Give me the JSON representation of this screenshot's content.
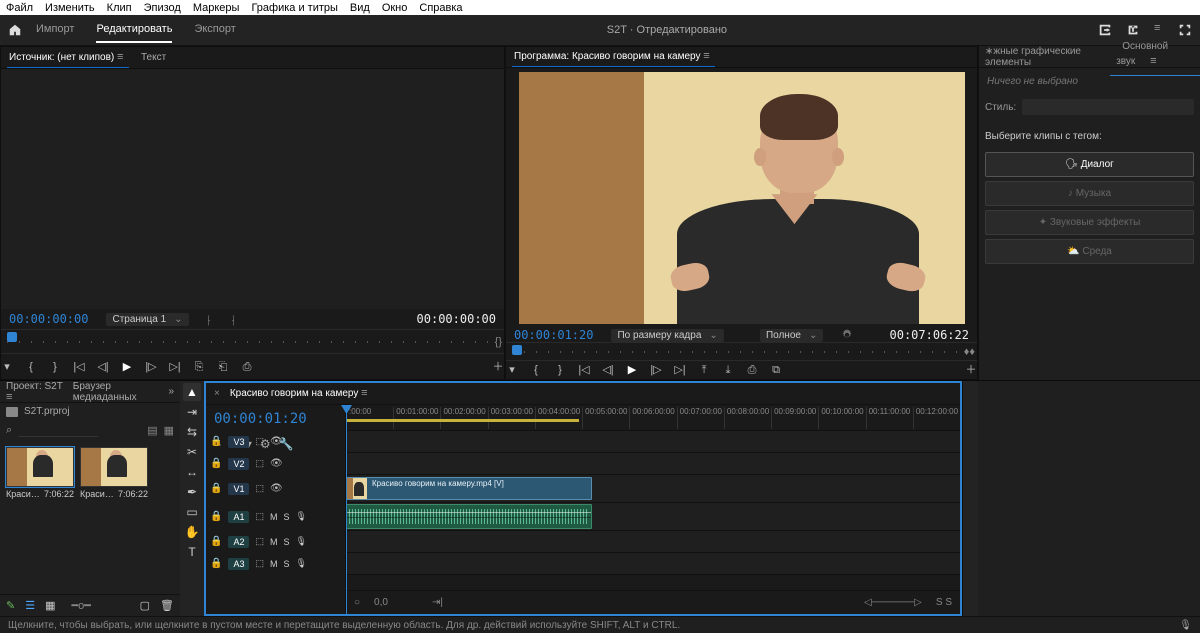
{
  "menubar": [
    "Файл",
    "Изменить",
    "Клип",
    "Эпизод",
    "Маркеры",
    "Графика и титры",
    "Вид",
    "Окно",
    "Справка"
  ],
  "topbar": {
    "tabs": [
      "Импорт",
      "Редактировать",
      "Экспорт"
    ],
    "active": 1,
    "title": "S2T  · Отредактировано"
  },
  "source": {
    "tab_source": "Источник: (нет клипов)",
    "tab_text": "Текст",
    "tc_left": "00:00:00:00",
    "page_dd": "Страница 1",
    "tc_right": "00:00:00:00"
  },
  "program": {
    "title": "Программа: Красиво говорим на камеру",
    "tc_left": "00:00:01:20",
    "fit_dd": "По размеру кадра",
    "quality_dd": "Полное",
    "duration": "00:07:06:22"
  },
  "ess": {
    "tab_egp": "∗жные графические элементы",
    "tab_audio": "Основной звук",
    "none": "Ничего не выбрано",
    "style_lbl": "Стиль:",
    "taghdr": "Выберите клипы с тегом:",
    "tags": [
      "Диалог",
      "Музыка",
      "Звуковые эффекты",
      "Среда"
    ]
  },
  "project": {
    "tab_project": "Проект: S2T",
    "tab_media": "Браузер медиаданных",
    "crumb": "S2T.prproj",
    "thumbs": [
      {
        "name": "Красиво гово…",
        "dur": "7:06:22"
      },
      {
        "name": "Красиво гово…",
        "dur": "7:06:22"
      }
    ]
  },
  "timeline": {
    "title": "Красиво говорим на камеру",
    "tc": "00:00:01:20",
    "ticks": [
      ":00:00",
      "00:01:00:00",
      "00:02:00:00",
      "00:03:00:00",
      "00:04:00:00",
      "00:05:00:00",
      "00:06:00:00",
      "00:07:00:00",
      "00:08:00:00",
      "00:09:00:00",
      "00:10:00:00",
      "00:11:00:00",
      "00:12:00:00"
    ],
    "v_tracks": [
      "V3",
      "V2",
      "V1"
    ],
    "a_tracks": [
      "A1",
      "A2",
      "A3"
    ],
    "clip_name": "Красиво говорим на камеру.mp4 [V]",
    "foot_zoom": "0,0"
  },
  "status": "Щелкните, чтобы выбрать, или щелкните в пустом месте и перетащите выделенную область. Для др. действий используйте SHIFT, ALT и CTRL."
}
